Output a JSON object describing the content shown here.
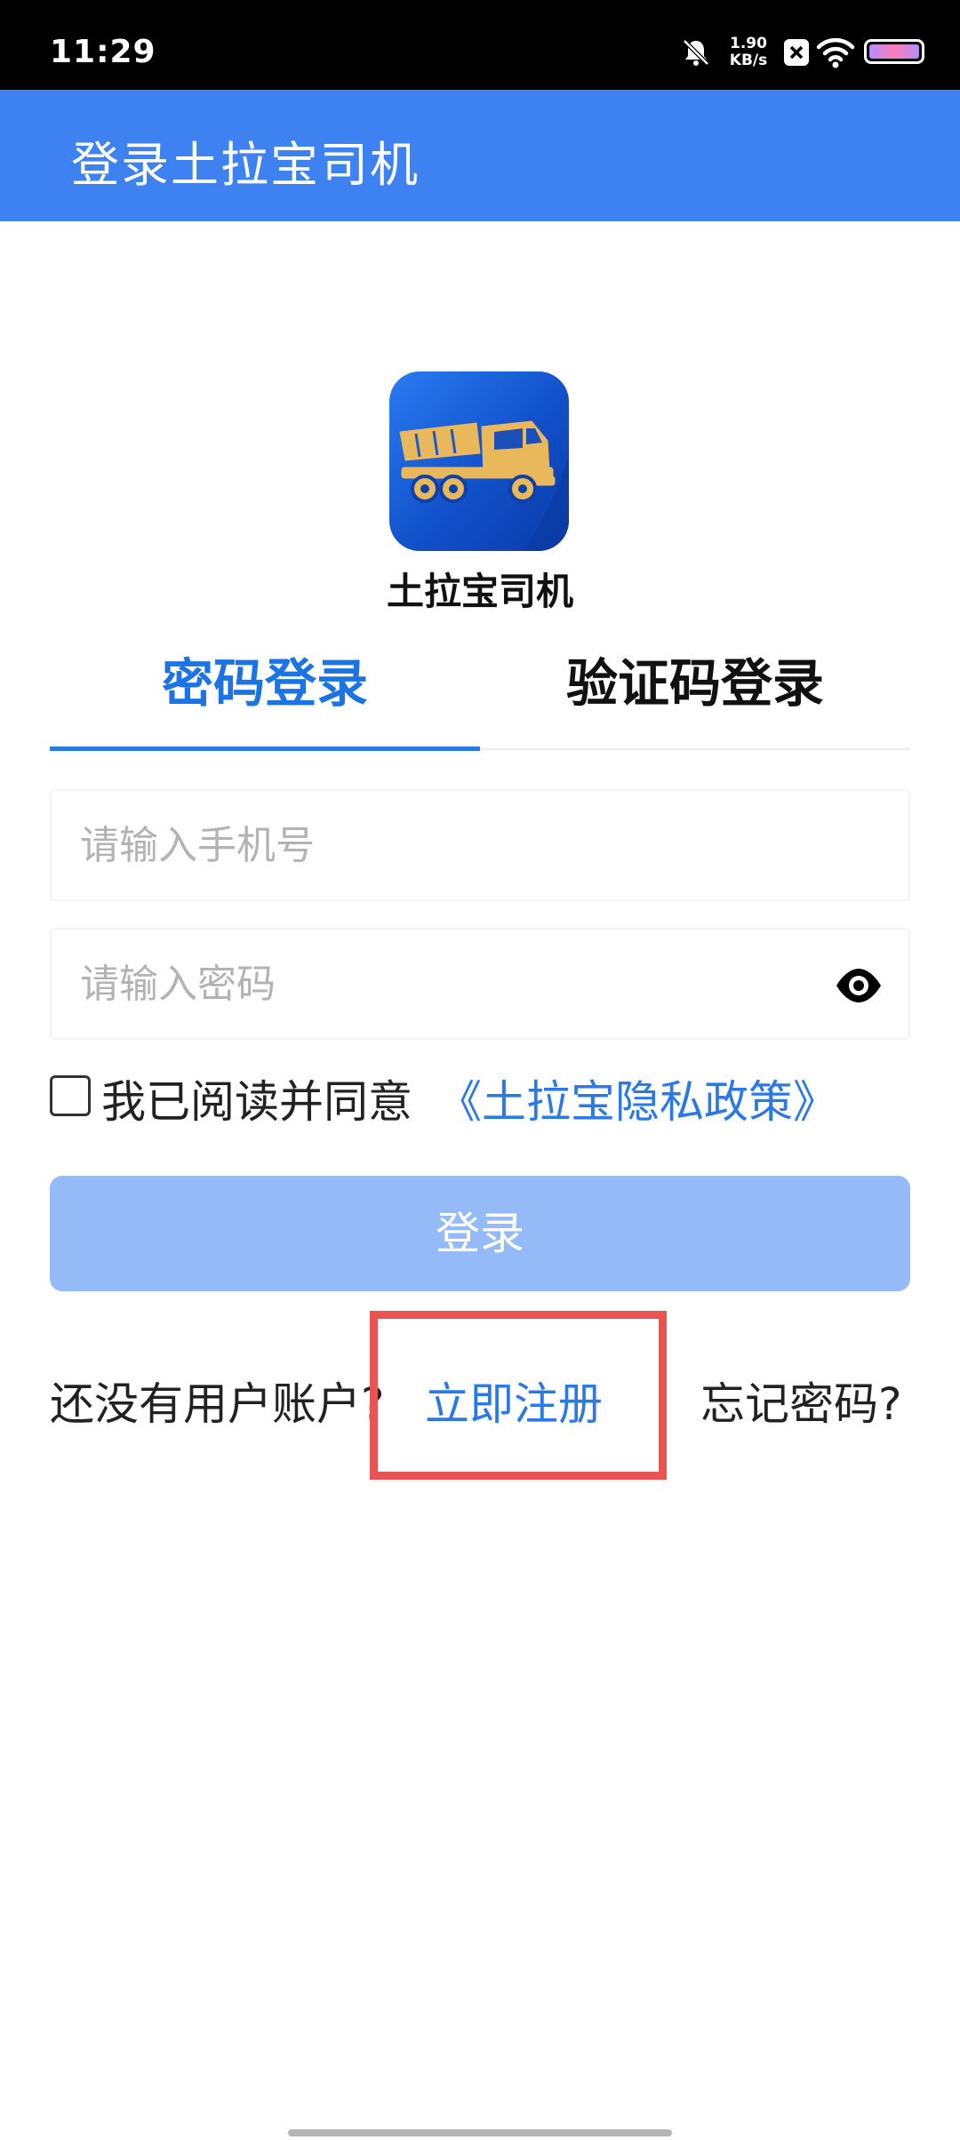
{
  "status_bar": {
    "time": "11:29",
    "net_speed_value": "1.90",
    "net_speed_unit": "KB/s"
  },
  "app_bar": {
    "title": "登录土拉宝司机"
  },
  "logo": {
    "app_name": "土拉宝司机"
  },
  "tabs": [
    {
      "label": "密码登录",
      "active": true
    },
    {
      "label": "验证码登录",
      "active": false
    }
  ],
  "form": {
    "phone_placeholder": "请输入手机号",
    "password_placeholder": "请输入密码",
    "agree_text": "我已阅读并同意",
    "privacy_link": "《土拉宝隐私政策》",
    "agree_checked": false,
    "login_label": "登录"
  },
  "footer": {
    "no_account_text": "还没有用户账户?",
    "register_label": "立即注册",
    "forgot_label": "忘记密码?"
  },
  "colors": {
    "app_bar": "#3d82f0",
    "accent": "#2b79e6",
    "login_button": "#94baf8",
    "highlight": "#e85353"
  }
}
